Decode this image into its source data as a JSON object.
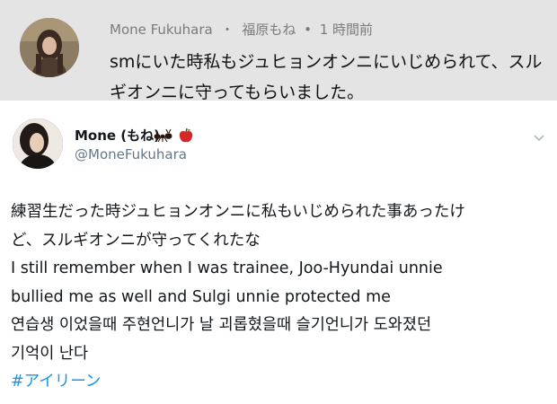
{
  "reply": {
    "display_name": "Mone Fukuhara",
    "separator": "・",
    "alt_name": "福原もね",
    "dot": "•",
    "time_ago": "1 時間前",
    "text": "smにいた時私もジュヒョンオンニにいじめられて、スルギオンニに守ってもらいました。"
  },
  "tweet": {
    "name": "Mone (もね)",
    "handle": "@MoneFukuhara",
    "body_lines": [
      "練習生だった時ジュヒョンオンニに私もいじめられた事あったけ",
      "ど、スルギオンニが守ってくれたな",
      "I still remember when I was trainee, Joo-Hyundai unnie",
      "bullied me as well and Sulgi unnie protected me",
      "연습생 이었을때 주현언니가 날 괴롭혔을때 슬기언니가 도와졌던",
      "기억이 난다"
    ],
    "hashtag": "#アイリーン"
  },
  "icons": {
    "name_emojis": [
      "ant-icon",
      "apple-icon"
    ],
    "menu": "chevron-down-icon"
  },
  "colors": {
    "panel_bg": "#e4e4e4",
    "meta_gray": "#7b7b7b",
    "handle_gray": "#657786",
    "hashtag_blue": "#1b95e0"
  }
}
